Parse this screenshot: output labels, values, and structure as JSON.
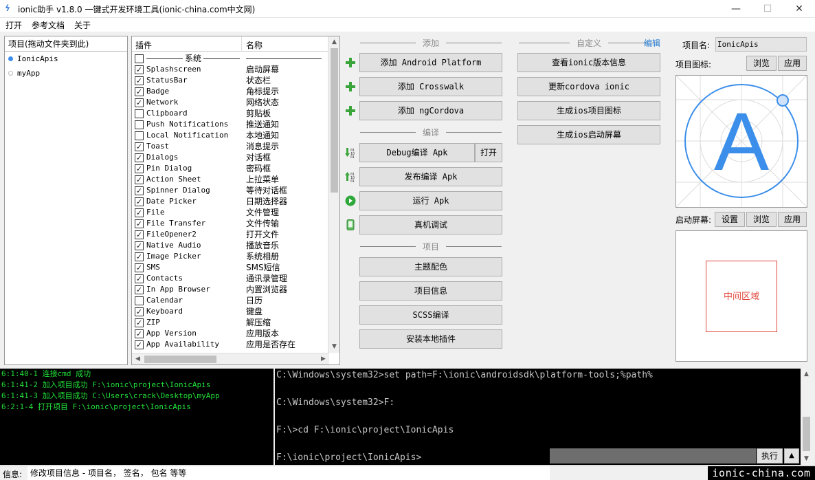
{
  "window": {
    "title": "ionic助手 v1.8.0 一键式开发环境工具(ionic-china.com中文网)",
    "icon": "ionic-helper-logo",
    "controls": {
      "minimize": "—",
      "maximize": "☐",
      "close": "✕"
    }
  },
  "menu": [
    "打开",
    "参考文档",
    "关于"
  ],
  "projects": {
    "header": "项目(拖动文件夹到此)",
    "items": [
      {
        "name": "IonicApis",
        "selected": true
      },
      {
        "name": "myApp",
        "selected": false
      }
    ]
  },
  "plugins": {
    "col_plugin": "插件",
    "col_name": "名称",
    "rows": [
      {
        "group": true,
        "label": "系统",
        "checked": false
      },
      {
        "name": "Splashscreen",
        "desc": "启动屏幕",
        "checked": true
      },
      {
        "name": "StatusBar",
        "desc": "状态栏",
        "checked": true
      },
      {
        "name": "Badge",
        "desc": "角标提示",
        "checked": true
      },
      {
        "name": "Network",
        "desc": "网络状态",
        "checked": true
      },
      {
        "name": "Clipboard",
        "desc": "剪贴板",
        "checked": false
      },
      {
        "name": "Push Notifications",
        "desc": "推送通知",
        "checked": false
      },
      {
        "name": "Local Notification",
        "desc": "本地通知",
        "checked": false
      },
      {
        "name": "Toast",
        "desc": "消息提示",
        "checked": true
      },
      {
        "name": "Dialogs",
        "desc": "对话框",
        "checked": true
      },
      {
        "name": "Pin Dialog",
        "desc": "密码框",
        "checked": true
      },
      {
        "name": "Action Sheet",
        "desc": "上拉菜单",
        "checked": true
      },
      {
        "name": "Spinner Dialog",
        "desc": "等待对话框",
        "checked": true
      },
      {
        "name": "Date Picker",
        "desc": "日期选择器",
        "checked": true
      },
      {
        "name": "File",
        "desc": "文件管理",
        "checked": true
      },
      {
        "name": "File Transfer",
        "desc": "文件传输",
        "checked": true
      },
      {
        "name": "FileOpener2",
        "desc": "打开文件",
        "checked": true
      },
      {
        "name": "Native Audio",
        "desc": "播放音乐",
        "checked": true
      },
      {
        "name": "Image Picker",
        "desc": "系统相册",
        "checked": true
      },
      {
        "name": "SMS",
        "desc": "SMS短信",
        "checked": true
      },
      {
        "name": "Contacts",
        "desc": "通讯录管理",
        "checked": true
      },
      {
        "name": "In App Browser",
        "desc": "内置浏览器",
        "checked": true
      },
      {
        "name": "Calendar",
        "desc": "日历",
        "checked": false
      },
      {
        "name": "Keyboard",
        "desc": "键盘",
        "checked": true
      },
      {
        "name": "ZIP",
        "desc": "解压缩",
        "checked": true
      },
      {
        "name": "App Version",
        "desc": "应用版本",
        "checked": true
      },
      {
        "name": "App Availability",
        "desc": "应用是否存在",
        "checked": true
      }
    ]
  },
  "sections": {
    "add": "添加",
    "compile": "编译",
    "project": "项目",
    "custom": "自定义",
    "edit": "编辑"
  },
  "buttons": {
    "add_android": "添加 Android Platform",
    "add_crosswalk": "添加 Crosswalk",
    "add_ngcordova": "添加 ngCordova",
    "debug_apk": "Debug编译 Apk",
    "open": "打开",
    "release_apk": "发布编译 Apk",
    "run_apk": "运行 Apk",
    "device_debug": "真机调试",
    "theme_color": "主题配色",
    "project_info": "项目信息",
    "scss_compile": "SCSS编译",
    "install_local_plugin": "安装本地插件",
    "view_ionic_version": "查看ionic版本信息",
    "update_cordova_ionic": "更新cordova ionic",
    "gen_ios_icon": "生成ios项目图标",
    "gen_ios_splash": "生成ios启动屏幕"
  },
  "config": {
    "name_label": "项目名:",
    "name_value": "IonicApis",
    "icon_label": "项目图标:",
    "browse": "浏览",
    "apply": "应用",
    "icon_letter": "A",
    "splash_label": "启动屏幕:",
    "set": "设置",
    "center_area": "中间区域"
  },
  "log": [
    "6:1:40-1 连接cmd 成功",
    "6:1:41-2 加入项目成功 F:\\ionic\\project\\IonicApis",
    "6:1:41-3 加入项目成功 C:\\Users\\crack\\Desktop\\myApp",
    "6:2:1-4 打开项目 F:\\ionic\\project\\IonicApis"
  ],
  "console": [
    "C:\\Windows\\system32>set path=F:\\ionic\\androidsdk\\platform-tools;%path%",
    "C:\\Windows\\system32>F:",
    "F:\\>cd F:\\ionic\\project\\IonicApis",
    "F:\\ionic\\project\\IonicApis>"
  ],
  "console_controls": {
    "exec": "执行",
    "up": "▲"
  },
  "status": {
    "label": "信息:",
    "message": "修改项目信息 - 项目名， 签名， 包名 等等",
    "brand": "ionic-china.com"
  },
  "colors": {
    "accent_blue": "#2a7fd4",
    "icon_blue": "#3b8eea",
    "log_green": "#22e03a",
    "splash_red": "#e0453a"
  }
}
